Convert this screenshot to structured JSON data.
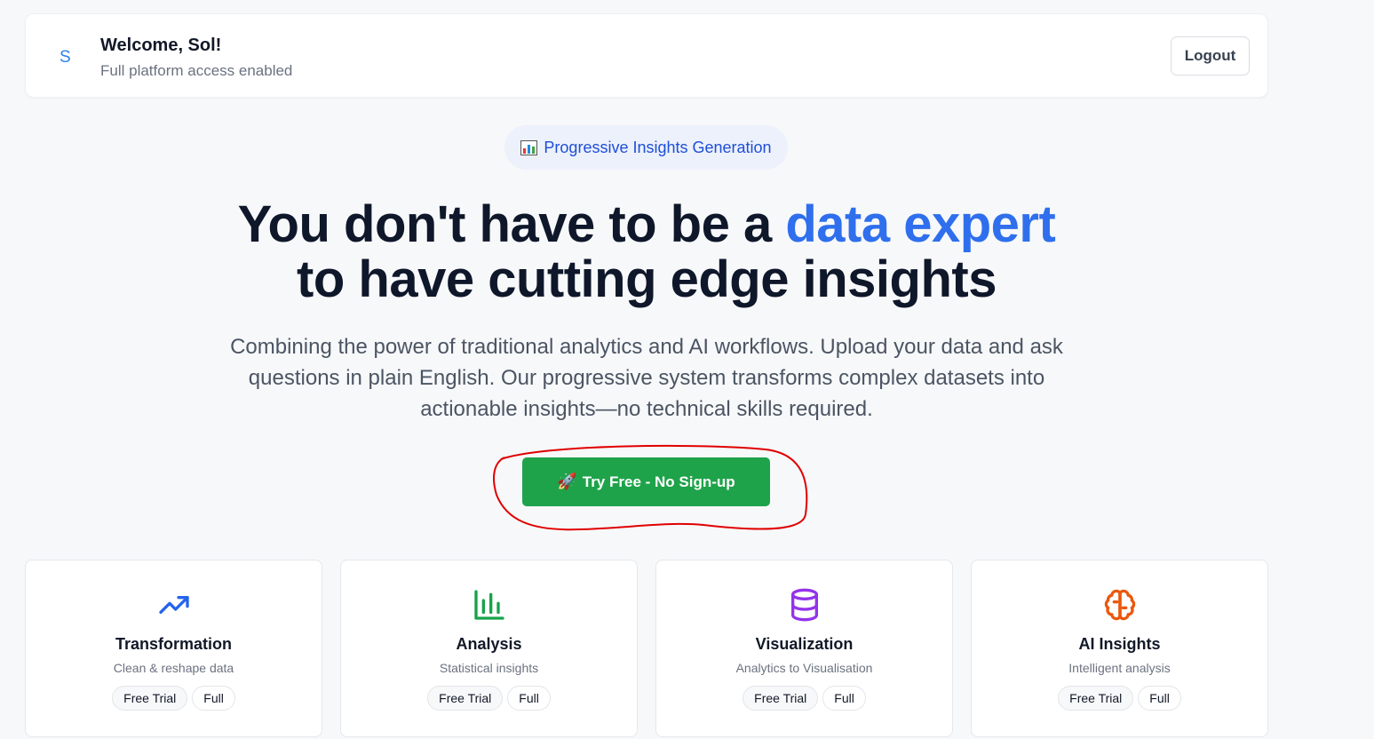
{
  "header": {
    "avatar_letter": "S",
    "welcome": "Welcome, Sol!",
    "access": "Full platform access enabled",
    "logout_label": "Logout"
  },
  "badge": {
    "icon": "bar-chart-icon",
    "label": "Progressive Insights Generation"
  },
  "hero": {
    "headline_part1": "You don't have to be a ",
    "headline_accent": "data expert",
    "headline_part2": " to have cutting edge insights",
    "subtitle": "Combining the power of traditional analytics and AI workflows. Upload your data and ask questions in plain English. Our progressive system transforms complex datasets into actionable insights—no technical skills required.",
    "cta_label": "Try Free - No Sign-up",
    "cta_icon": "🚀"
  },
  "features": [
    {
      "icon": "trending-up-icon",
      "title": "Transformation",
      "desc": "Clean & reshape data",
      "tag1": "Free Trial",
      "tag2": "Full",
      "color": "#2563eb"
    },
    {
      "icon": "bar-chart-icon",
      "title": "Analysis",
      "desc": "Statistical insights",
      "tag1": "Free Trial",
      "tag2": "Full",
      "color": "#16a34a"
    },
    {
      "icon": "database-icon",
      "title": "Visualization",
      "desc": "Analytics to Visualisation",
      "tag1": "Free Trial",
      "tag2": "Full",
      "color": "#9333ea"
    },
    {
      "icon": "brain-icon",
      "title": "AI Insights",
      "desc": "Intelligent analysis",
      "tag1": "Free Trial",
      "tag2": "Full",
      "color": "#ea580c"
    }
  ],
  "colors": {
    "accent": "#2f6fed",
    "cta": "#1fa34a",
    "annotation": "#e00000"
  }
}
